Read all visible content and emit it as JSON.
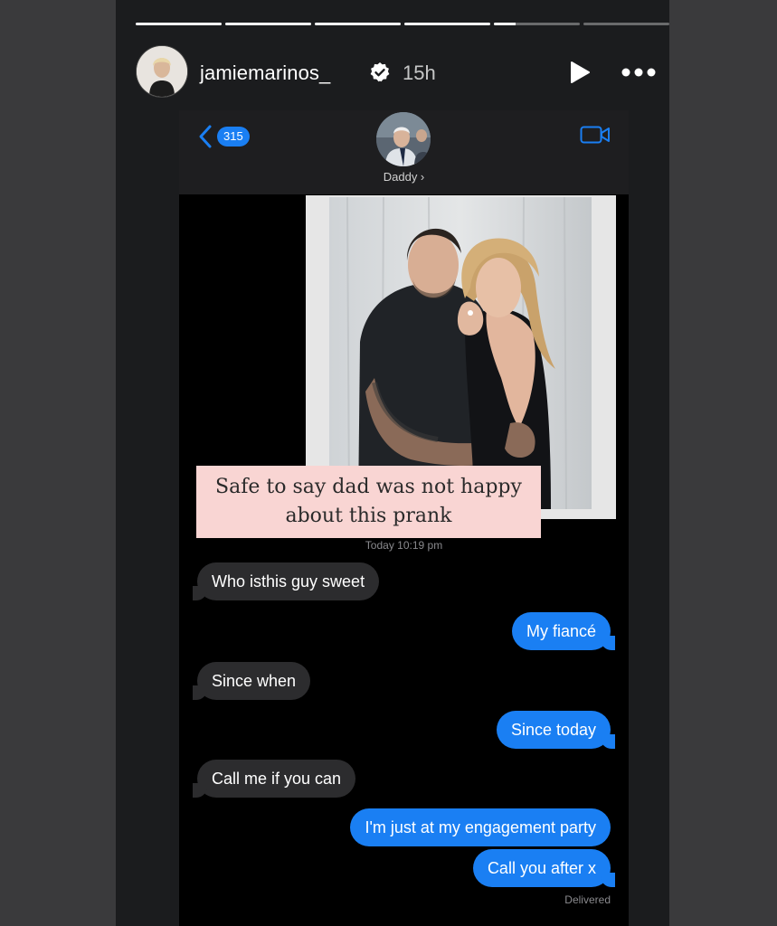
{
  "story": {
    "progress": [
      1,
      1,
      1,
      1,
      0.25,
      0
    ],
    "username": "jamiemarinos_",
    "time_ago": "15h",
    "icons": {
      "verified": "verified-badge-icon",
      "play": "play-icon",
      "more": "more-icon"
    }
  },
  "imessage": {
    "back_count": "315",
    "contact_name": "Daddy ›",
    "timestamp": "Today 10:19 pm",
    "delivered": "Delivered",
    "accent": "#1a7ff3",
    "messages": [
      {
        "from": "them",
        "text": "Who isthis guy sweet"
      },
      {
        "from": "me",
        "text": "My fiancé"
      },
      {
        "from": "them",
        "text": "Since when"
      },
      {
        "from": "me",
        "text": "Since today"
      },
      {
        "from": "them",
        "text": "Call me if you can"
      },
      {
        "from": "me",
        "text": "I'm just at my engagement party"
      },
      {
        "from": "me",
        "text": "Call you after x"
      }
    ]
  },
  "caption": {
    "line1": "Safe to say dad was not happy",
    "line2": "about this prank",
    "background": "#f9d5d3"
  }
}
